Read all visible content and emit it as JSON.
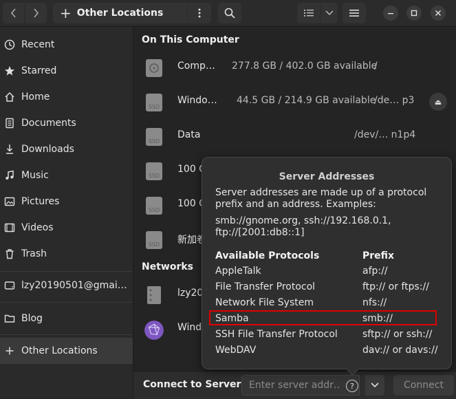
{
  "header": {
    "location_label": "Other Locations"
  },
  "sidebar": {
    "items": [
      {
        "label": "Recent",
        "icon": "clock-icon"
      },
      {
        "label": "Starred",
        "icon": "star-icon"
      },
      {
        "label": "Home",
        "icon": "home-icon"
      },
      {
        "label": "Documents",
        "icon": "document-icon"
      },
      {
        "label": "Downloads",
        "icon": "download-icon"
      },
      {
        "label": "Music",
        "icon": "music-icon"
      },
      {
        "label": "Pictures",
        "icon": "picture-icon"
      },
      {
        "label": "Videos",
        "icon": "video-icon"
      },
      {
        "label": "Trash",
        "icon": "trash-icon"
      },
      {
        "label": "lzy20190501@gmai…",
        "icon": "account-icon"
      },
      {
        "label": "Blog",
        "icon": "folder-icon"
      },
      {
        "label": "Other Locations",
        "icon": "plus-icon",
        "selected": true
      }
    ]
  },
  "main": {
    "on_this_computer": "On This Computer",
    "networks": "Networks",
    "drives": [
      {
        "name": "Comp…",
        "capacity": "277.8 GB / 402.0 GB available",
        "mount": "/",
        "icon": "hard-disk-icon"
      },
      {
        "name": "Windo…",
        "capacity": "44.5 GB / 214.9 GB available",
        "mount": "/de… p3",
        "icon": "ssd-icon",
        "eject": true
      },
      {
        "name": "Data",
        "capacity": "",
        "mount": "/dev/… n1p4",
        "icon": "ssd-icon"
      },
      {
        "name": "100 C",
        "capacity": "",
        "mount": "",
        "icon": "ssd-icon"
      },
      {
        "name": "100 C",
        "capacity": "",
        "mount": "",
        "icon": "ssd-icon"
      },
      {
        "name": "新加卷",
        "capacity": "",
        "mount": "",
        "icon": "ssd-icon"
      }
    ],
    "network_items": [
      {
        "name": "lzy20",
        "icon": "server-icon"
      },
      {
        "name": "Wind",
        "icon": "network-globe-icon"
      }
    ]
  },
  "connect": {
    "label": "Connect to Server",
    "placeholder": "Enter server addr…",
    "button": "Connect"
  },
  "popover": {
    "title": "Server Addresses",
    "description": "Server addresses are made up of a protocol prefix and an address. Examples:",
    "examples": "smb://gnome.org, ssh://192.168.0.1, ftp://[2001:db8::1]",
    "col_protocols": "Available Protocols",
    "col_prefix": "Prefix",
    "protocols": [
      {
        "name": "AppleTalk",
        "prefix": "afp://"
      },
      {
        "name": "File Transfer Protocol",
        "prefix": "ftp:// or ftps://"
      },
      {
        "name": "Network File System",
        "prefix": "nfs://"
      },
      {
        "name": "Samba",
        "prefix": "smb://",
        "highlighted": true
      },
      {
        "name": "SSH File Transfer Protocol",
        "prefix": "sftp:// or ssh://"
      },
      {
        "name": "WebDAV",
        "prefix": "dav:// or davs://"
      }
    ]
  },
  "colors": {
    "highlight_border": "#e00000",
    "background": "#242424"
  }
}
